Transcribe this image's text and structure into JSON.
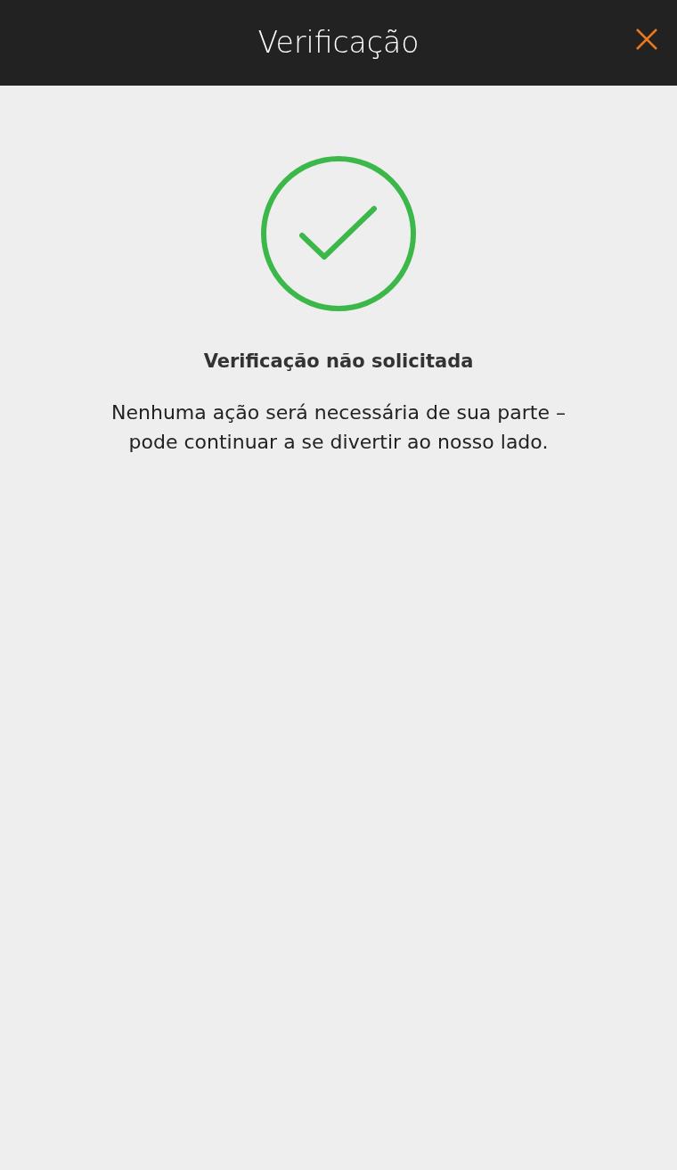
{
  "header": {
    "title": "Verificação"
  },
  "status": {
    "kind": "success",
    "heading": "Verificação não solicitada",
    "message": "Nenhuma ação será necessária de sua parte – pode continuar a se divertir ao nosso lado."
  }
}
